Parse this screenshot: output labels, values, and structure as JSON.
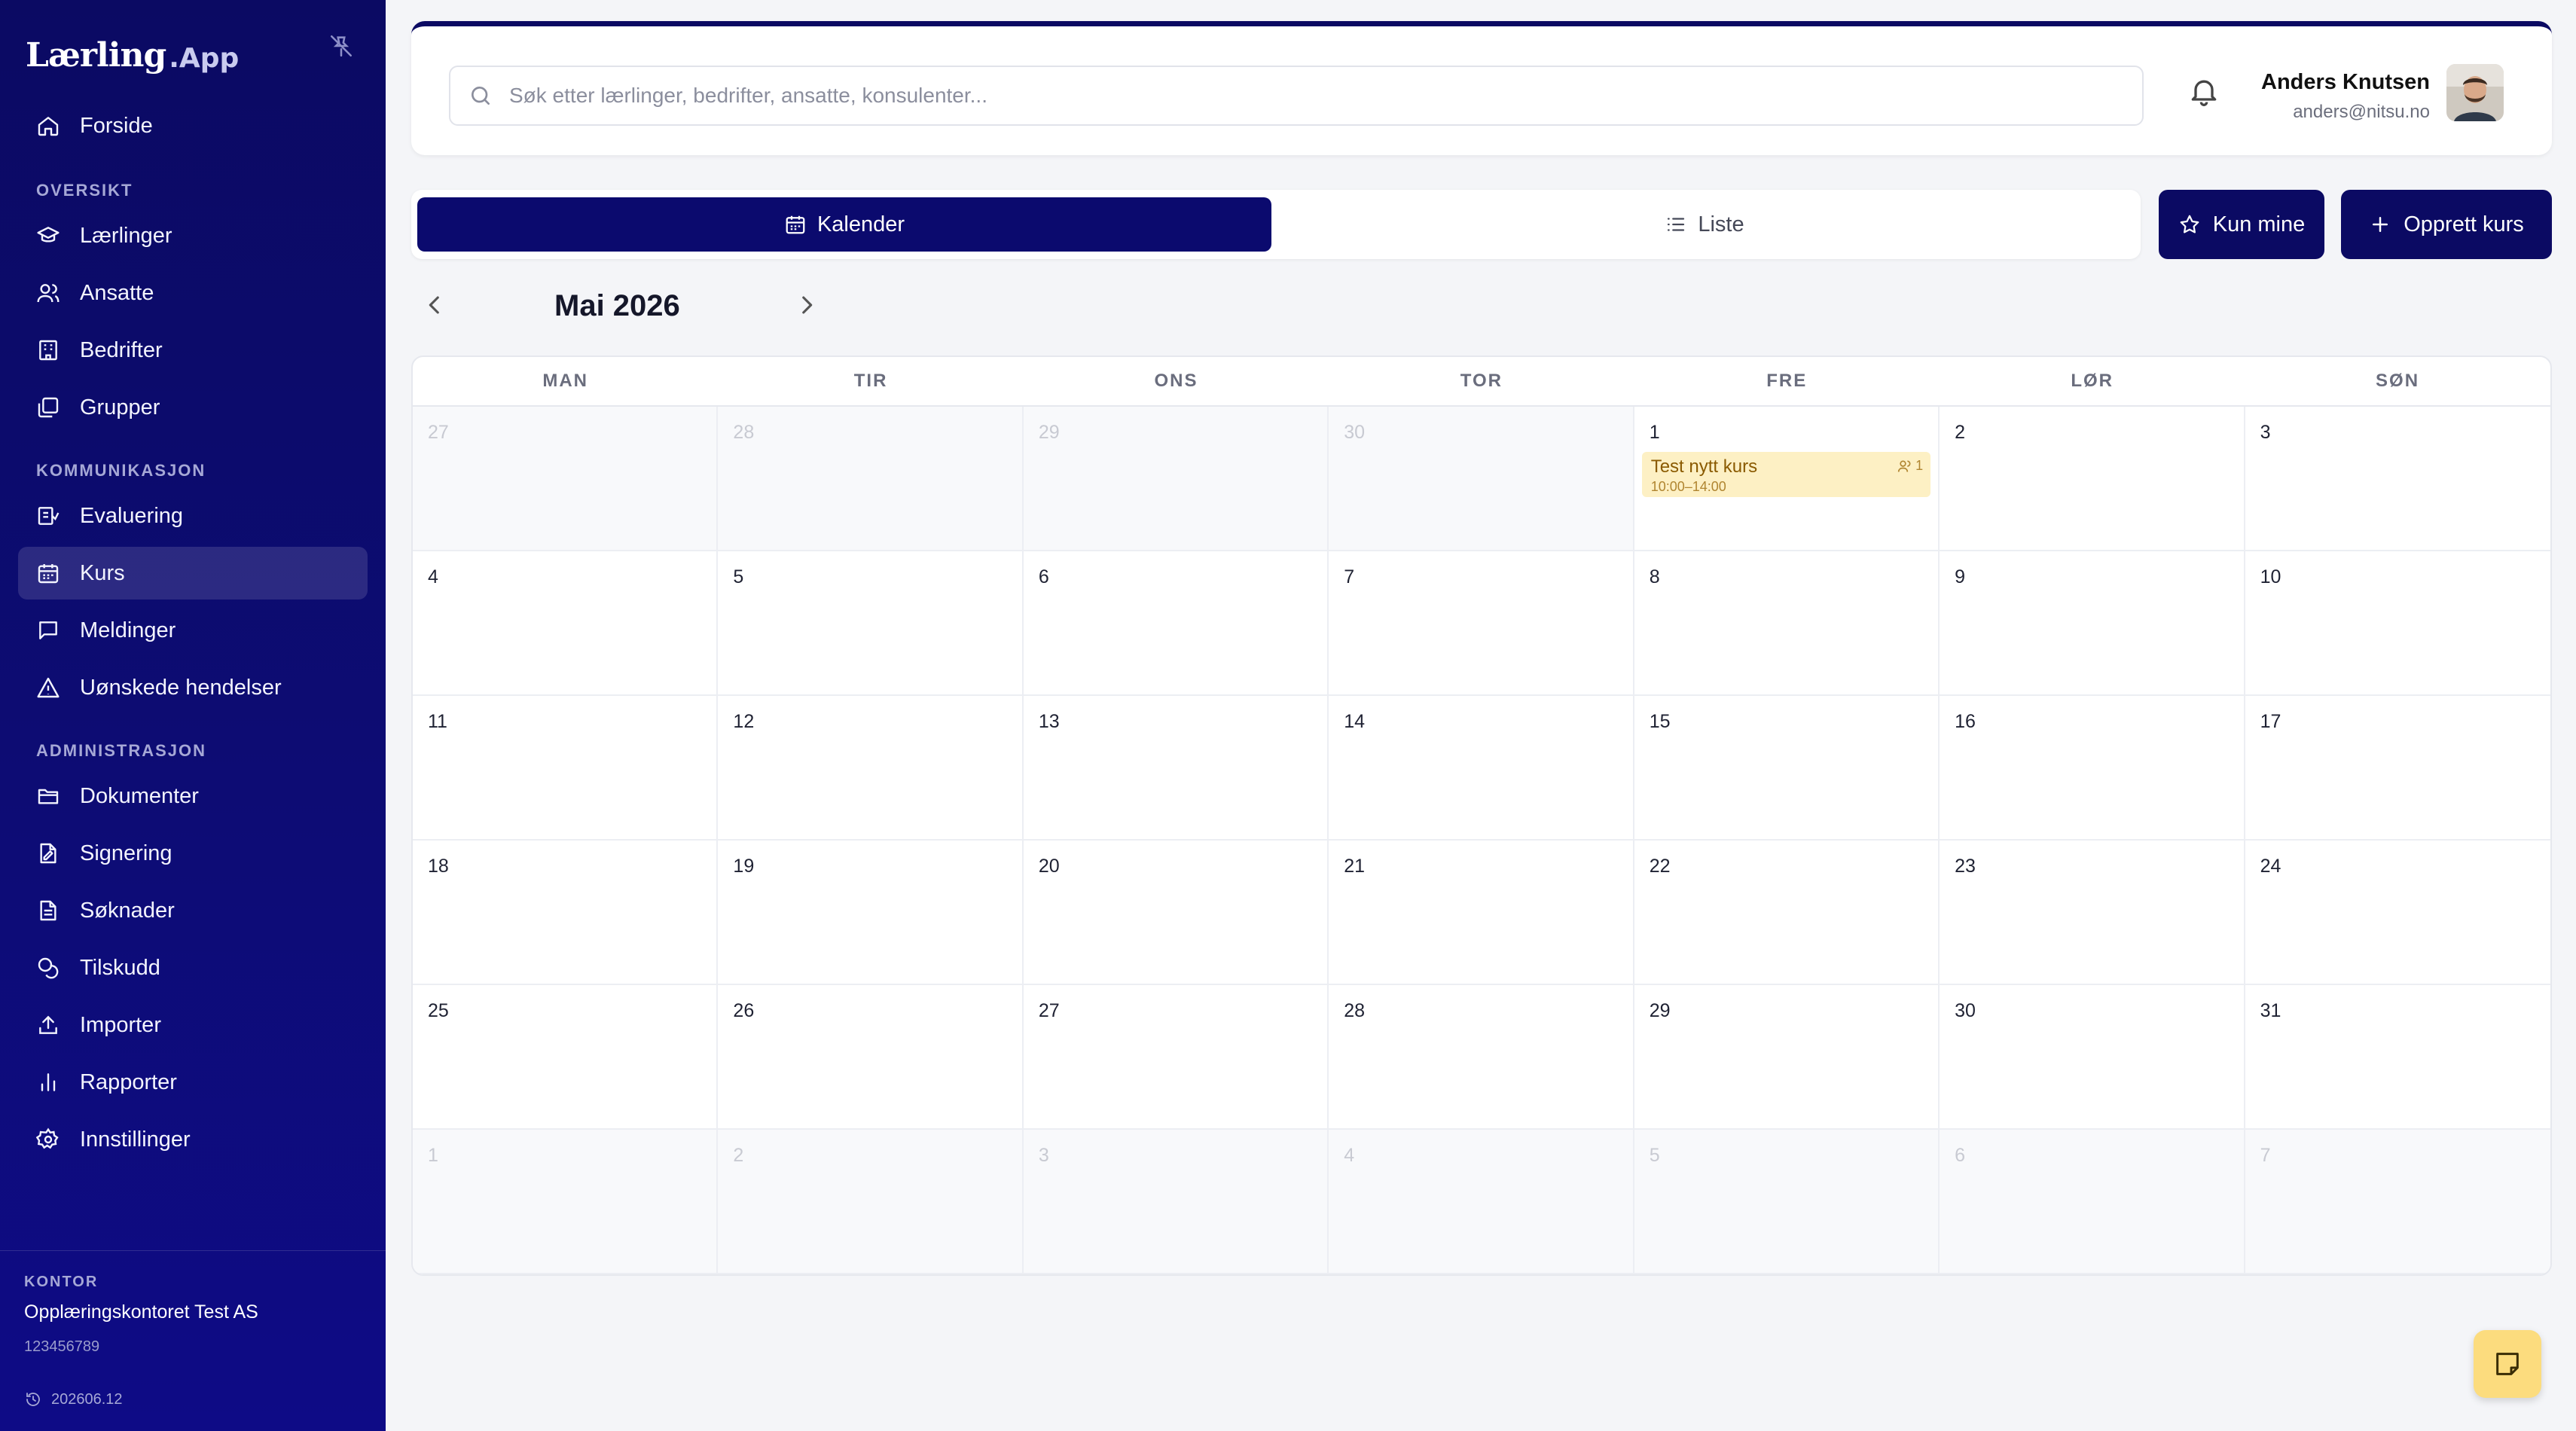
{
  "app": {
    "logo_main": "Lærling",
    "logo_sub": ".App"
  },
  "sidebar": {
    "home": "Forside",
    "sections": {
      "oversikt": "OVERSIKT",
      "kommunikasjon": "KOMMUNIKASJON",
      "administrasjon": "ADMINISTRASJON"
    },
    "oversikt_items": [
      "Lærlinger",
      "Ansatte",
      "Bedrifter",
      "Grupper"
    ],
    "kommunikasjon_items": [
      "Evaluering",
      "Kurs",
      "Meldinger",
      "Uønskede hendelser"
    ],
    "administrasjon_items": [
      "Dokumenter",
      "Signering",
      "Søknader",
      "Tilskudd",
      "Importer",
      "Rapporter",
      "Innstillinger"
    ],
    "active_item": "Kurs",
    "office": {
      "label": "KONTOR",
      "name": "Opplæringskontoret Test AS",
      "number": "123456789"
    },
    "version": "202606.12"
  },
  "header": {
    "search_placeholder": "Søk etter lærlinger, bedrifter, ansatte, konsulenter...",
    "user_name": "Anders Knutsen",
    "user_email": "anders@nitsu.no"
  },
  "toolbar": {
    "calendar_label": "Kalender",
    "list_label": "Liste",
    "only_mine_label": "Kun mine",
    "create_course_label": "Opprett kurs"
  },
  "calendar": {
    "month_title": "Mai 2026",
    "weekdays": [
      "MAN",
      "TIR",
      "ONS",
      "TOR",
      "FRE",
      "LØR",
      "SØN"
    ],
    "weeks": [
      [
        "27",
        "28",
        "29",
        "30",
        "1",
        "2",
        "3"
      ],
      [
        "4",
        "5",
        "6",
        "7",
        "8",
        "9",
        "10"
      ],
      [
        "11",
        "12",
        "13",
        "14",
        "15",
        "16",
        "17"
      ],
      [
        "18",
        "19",
        "20",
        "21",
        "22",
        "23",
        "24"
      ],
      [
        "25",
        "26",
        "27",
        "28",
        "29",
        "30",
        "31"
      ],
      [
        "1",
        "2",
        "3",
        "4",
        "5",
        "6",
        "7"
      ]
    ],
    "event": {
      "title": "Test nytt kurs",
      "time": "10:00–14:00",
      "participants": "1"
    }
  },
  "colors": {
    "brand": "#0b0a63",
    "event_bg": "#fdf0c4",
    "fab": "#fcdc7e"
  }
}
